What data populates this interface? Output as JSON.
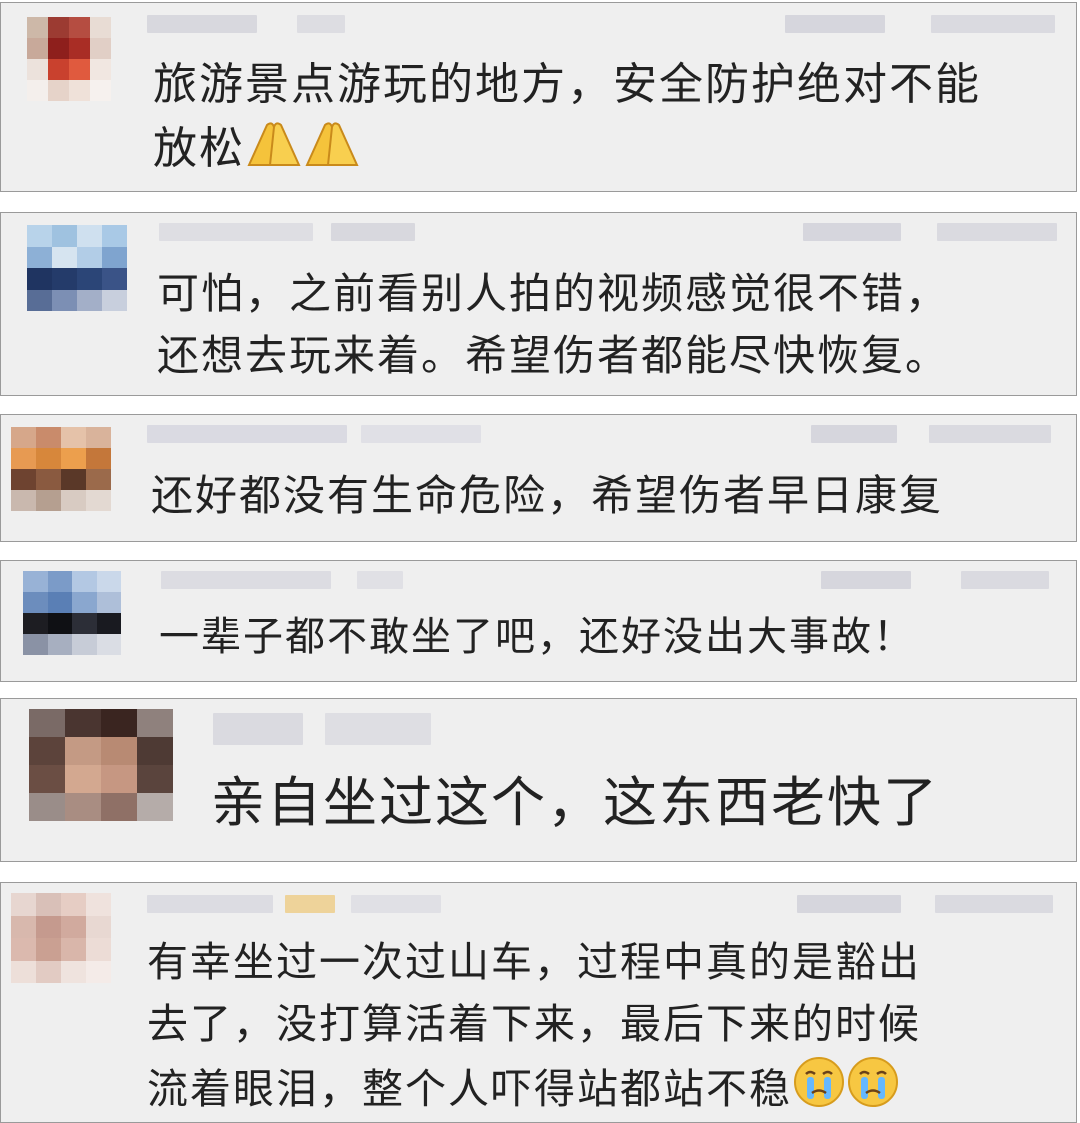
{
  "comments": [
    {
      "lines": [
        "旅游景点游玩的地方，安全防护绝对不能",
        "放松"
      ],
      "emojis": [
        "pray-hands-emoji",
        "pray-hands-emoji"
      ]
    },
    {
      "lines": [
        "可怕，之前看别人拍的视频感觉很不错，",
        "还想去玩来着。希望伤者都能尽快恢复。"
      ],
      "emojis": []
    },
    {
      "lines": [
        "还好都没有生命危险，希望伤者早日康复"
      ],
      "emojis": []
    },
    {
      "lines": [
        "一辈子都不敢坐了吧，还好没出大事故！"
      ],
      "emojis": []
    },
    {
      "lines": [
        "亲自坐过这个，这东西老快了"
      ],
      "emojis": []
    },
    {
      "lines": [
        "有幸坐过一次过山车，过程中真的是豁出",
        "去了，没打算活着下来，最后下来的时候",
        "流着眼泪，整个人吓得站都站不稳"
      ],
      "emojis": [
        "crying-face-emoji",
        "crying-face-emoji"
      ]
    }
  ],
  "colors": {
    "card_background": "#efefef",
    "card_border": "#9a9a9a",
    "text": "#222222",
    "blur_gray": "#d9d9de"
  }
}
